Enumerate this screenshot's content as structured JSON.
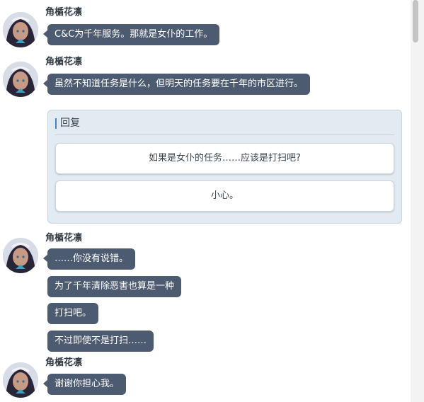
{
  "character_name": "角楯花凛",
  "messages": [
    {
      "speaker": "角楯花凛",
      "lines": [
        "C&C为千年服务。那就是女仆的工作。"
      ]
    },
    {
      "speaker": "角楯花凛",
      "lines": [
        "虽然不知道任务是什么，但明天的任务要在千年的市区进行。"
      ]
    },
    {
      "speaker": "角楯花凛",
      "lines": [
        "……你没有说错。",
        "为了千年清除恶害也算是一种",
        "打扫吧。",
        "不过即使不是打扫……"
      ]
    },
    {
      "speaker": "角楯花凛",
      "lines": [
        "谢谢你担心我。"
      ]
    }
  ],
  "reply": {
    "label": "回复",
    "options": [
      "如果是女仆的任务……应该是打扫吧?",
      "小心。"
    ]
  },
  "colors": {
    "bubble": "#4c5b6f",
    "reply_panel": "#e1ebf1",
    "reply_accent": "#2f8ed6"
  },
  "icons": {
    "avatar": "character-portrait-avatar"
  }
}
